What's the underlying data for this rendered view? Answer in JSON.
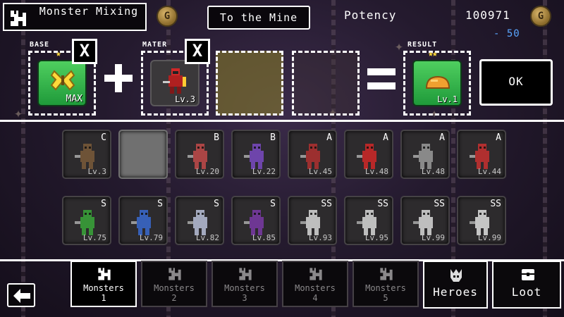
{
  "header": {
    "title": "Monster Mixing",
    "mine_button": "To the Mine",
    "potency_label": "Potency",
    "gold_amount": "100971",
    "gold_delta": "- 50",
    "gold_icon_letter": "G"
  },
  "mixing": {
    "base_label": "BASE",
    "mater_label": "MATER",
    "result_label": "RESULT",
    "base_level": "MAX",
    "mater_level": "Lv.3",
    "result_level": "Lv.1",
    "remove_label": "X",
    "ok_label": "OK",
    "base_stars": "★",
    "result_stars": "★★",
    "colors": {
      "slot_border": "#ffffff",
      "tile_green": "#2fb24a",
      "star": "#ffd93a",
      "empty_slot_tint": "#7f7a2a"
    }
  },
  "monsters": [
    {
      "grade": "C",
      "level": "Lv.3",
      "sprite": "scarecrow-icon",
      "color": "#7a5a3a"
    },
    {
      "grade": "",
      "level": "",
      "sprite": "empty",
      "color": "#707070"
    },
    {
      "grade": "B",
      "level": "Lv.20",
      "sprite": "crab-knight-icon",
      "color": "#c24a4a"
    },
    {
      "grade": "B",
      "level": "Lv.22",
      "sprite": "purple-crab-icon",
      "color": "#7a4ac2"
    },
    {
      "grade": "A",
      "level": "Lv.45",
      "sprite": "dark-warrior-icon",
      "color": "#b03030"
    },
    {
      "grade": "A",
      "level": "Lv.48",
      "sprite": "red-warrior-icon",
      "color": "#d02828"
    },
    {
      "grade": "A",
      "level": "Lv.48",
      "sprite": "grey-knight-icon",
      "color": "#9a9a9a"
    },
    {
      "grade": "A",
      "level": "Lv.44",
      "sprite": "red-mage-icon",
      "color": "#c83030"
    },
    {
      "grade": "S",
      "level": "Lv.75",
      "sprite": "green-beast-icon",
      "color": "#3aa63a"
    },
    {
      "grade": "S",
      "level": "Lv.79",
      "sprite": "blue-wizard-icon",
      "color": "#3a6ad0"
    },
    {
      "grade": "S",
      "level": "Lv.82",
      "sprite": "white-wizard-icon",
      "color": "#b8c0d8"
    },
    {
      "grade": "S",
      "level": "Lv.85",
      "sprite": "purple-beast-icon",
      "color": "#7a3aa6"
    },
    {
      "grade": "SS",
      "level": "Lv.93",
      "sprite": "bone-beast-icon",
      "color": "#d8d8d8"
    },
    {
      "grade": "SS",
      "level": "Lv.95",
      "sprite": "bone-mage-icon",
      "color": "#d8d8d8"
    },
    {
      "grade": "SS",
      "level": "Lv.99",
      "sprite": "bone-tower-icon",
      "color": "#d8d8d8"
    },
    {
      "grade": "SS",
      "level": "Lv.99",
      "sprite": "silver-knight-icon",
      "color": "#e0e0e0"
    }
  ],
  "tabs": [
    {
      "line1": "Monsters",
      "line2": "1"
    },
    {
      "line1": "Monsters",
      "line2": "2"
    },
    {
      "line1": "Monsters",
      "line2": "3"
    },
    {
      "line1": "Monsters",
      "line2": "4"
    },
    {
      "line1": "Monsters",
      "line2": "5"
    }
  ],
  "side_buttons": {
    "heroes": "Heroes",
    "loot": "Loot"
  }
}
